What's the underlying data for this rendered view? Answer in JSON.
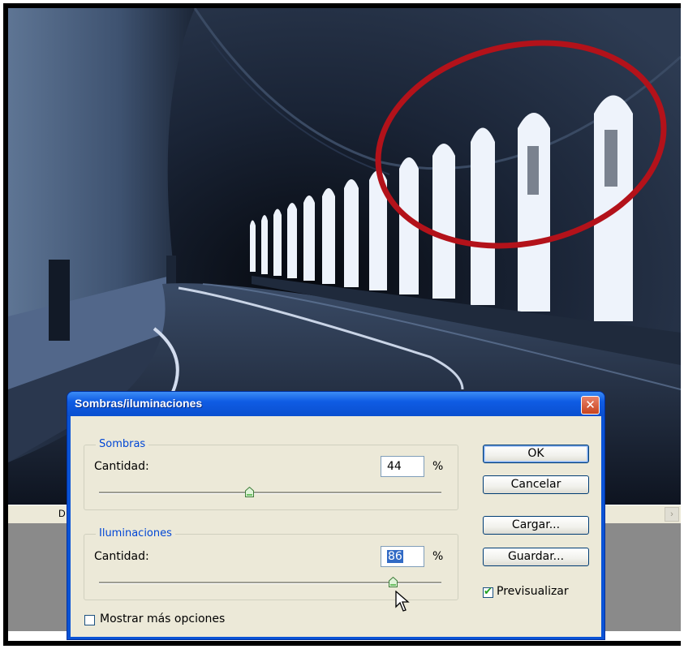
{
  "dialog": {
    "title": "Sombras/iluminaciones",
    "close_glyph": "✕",
    "shadows": {
      "legend": "Sombras",
      "amount_label": "Cantidad:",
      "amount_value": "44",
      "unit": "%",
      "slider_level": 0.44
    },
    "highlights": {
      "legend": "Iluminaciones",
      "amount_label": "Cantidad:",
      "amount_value": "86",
      "unit": "%",
      "slider_level": 0.86
    },
    "buttons": {
      "ok": "OK",
      "cancel": "Cancelar",
      "load": "Cargar...",
      "save": "Guardar..."
    },
    "preview": {
      "label": "Previsualizar",
      "checked": true
    },
    "more_options": {
      "label": "Mostrar más opciones",
      "checked": false
    }
  },
  "statusbar": {
    "text": "D"
  },
  "colors": {
    "title_bar": "#0a53d6",
    "dialog_body": "#ece9d8",
    "legend_text": "#0046d5",
    "highlight_ring": "#b3121a"
  },
  "icons": [
    "close-icon",
    "slider-thumb-icon",
    "checkmark-icon",
    "mouse-cursor-icon"
  ]
}
